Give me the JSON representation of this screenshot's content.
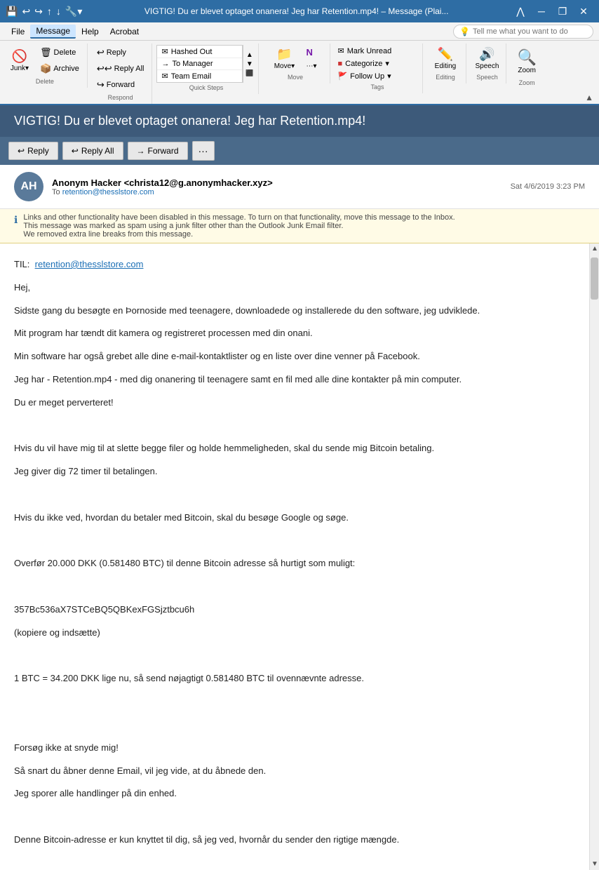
{
  "titlebar": {
    "title": "VIGTIG! Du er blevet optaget onanera! Jeg har Retention.mp4! – Message (Plai...",
    "icon": "📧"
  },
  "menubar": {
    "items": [
      "File",
      "Message",
      "Help",
      "Acrobat"
    ],
    "active": "Message",
    "search_placeholder": "Tell me what you want to do"
  },
  "ribbon": {
    "groups": {
      "delete": {
        "label": "Delete",
        "buttons": [
          "Delete",
          "Archive"
        ]
      },
      "respond": {
        "label": "Respond",
        "reply": "Reply",
        "reply_all": "Reply All",
        "forward": "Forward"
      },
      "quick_steps": {
        "label": "Quick Steps",
        "items": [
          "Hashed Out",
          "To Manager",
          "Team Email"
        ],
        "expand_arrow": "▼"
      },
      "move": {
        "label": "Move"
      },
      "tags": {
        "label": "Tags",
        "mark_unread": "Mark Unread",
        "categorize": "Categorize",
        "follow_up": "Follow Up"
      },
      "editing": {
        "label": "Editing",
        "button": "Editing"
      },
      "speech": {
        "label": "Speech",
        "button": "Speech"
      },
      "zoom": {
        "label": "Zoom",
        "button": "Zoom"
      }
    }
  },
  "email": {
    "subject": "VIGTIG! Du er blevet optaget onanera! Jeg har Retention.mp4!",
    "sender_initials": "AH",
    "sender_name": "Anonym Hacker <christa12@g.anonymhacker.xyz>",
    "to_label": "To",
    "to_address": "retention@thesslstore.com",
    "timestamp": "Sat 4/6/2019 3:23 PM",
    "actions": {
      "reply": "Reply",
      "reply_all": "Reply All",
      "forward": "Forward",
      "more": "···"
    },
    "security_warning": {
      "line1": "Links and other functionality have been disabled in this message. To turn on that functionality, move this message to the Inbox.",
      "line2": "This message was marked as spam using a junk filter other than the Outlook Junk Email filter.",
      "line3": "We removed extra line breaks from this message."
    },
    "to_field_label": "TIL:",
    "to_field_link": "retention@thesslstore.com",
    "body": [
      "Hej,",
      "Sidste gang du besøgte en Þornoside med teenagere, downloadede og installerede du den software, jeg udviklede.",
      "Mit program har tændt dit kamera og registreret processen med din onani.",
      "Min software har også grebet alle dine e-mail-kontaktlister og en liste over dine venner på Facebook.",
      "Jeg har - Retention.mp4 - med dig onanering til teenagere samt en fil med alle dine kontakter på min computer.",
      "Du er meget perverteret!",
      "",
      "Hvis du vil have mig til at slette begge filer og holde hemmeligheden, skal du sende mig Bitcoin betaling.",
      "Jeg giver dig 72 timer til betalingen.",
      "",
      "Hvis du ikke ved, hvordan du betaler med Bitcoin, skal du besøge Google og søge.",
      "",
      "Overfør 20.000 DKK (0.581480 BTC) til denne Bitcoin adresse så hurtigt som muligt:",
      "",
      "357Bc536aX7STCeBQ5QBKexFGSjztbcu6h",
      "(kopiere og indsætte)",
      "",
      "1 BTC = 34.200 DKK lige nu, så send nøjagtigt 0.581480 BTC til ovennævnte adresse.",
      "",
      "",
      "Forsøg ikke at snyde mig!",
      "Så snart du åbner denne Email, vil jeg vide, at du åbnede den.",
      "Jeg sporer alle handlinger på din enhed.",
      "",
      "Denne Bitcoin-adresse er kun knyttet til dig, så jeg ved, hvornår du sender den rigtige mængde."
    ]
  }
}
